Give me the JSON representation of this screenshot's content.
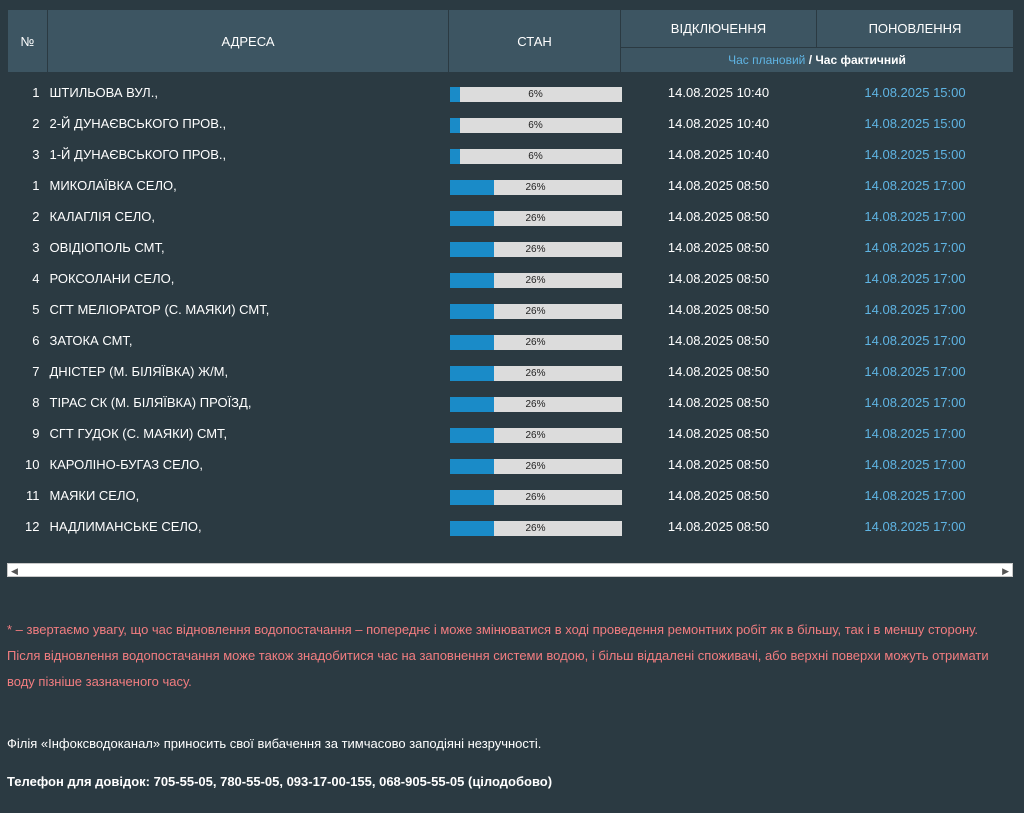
{
  "header": {
    "num": "№",
    "address": "АДРЕСА",
    "state": "СТАН",
    "disconnection": "ВІДКЛЮЧЕННЯ",
    "restoration": "ПОНОВЛЕННЯ",
    "planned_time": "Час плановий",
    "separator": " / ",
    "actual_time": "Час фактичний"
  },
  "rows": [
    {
      "num": "1",
      "address": "ШТИЛЬОВА ВУЛ.,",
      "progress": 6,
      "progress_label": "6%",
      "off": "14.08.2025 10:40",
      "upd": "14.08.2025 15:00"
    },
    {
      "num": "2",
      "address": "2-Й ДУНАЄВСЬКОГО ПРОВ.,",
      "progress": 6,
      "progress_label": "6%",
      "off": "14.08.2025 10:40",
      "upd": "14.08.2025 15:00"
    },
    {
      "num": "3",
      "address": "1-Й ДУНАЄВСЬКОГО ПРОВ.,",
      "progress": 6,
      "progress_label": "6%",
      "off": "14.08.2025 10:40",
      "upd": "14.08.2025 15:00"
    },
    {
      "num": "1",
      "address": "МИКОЛАЇВКА СЕЛО,",
      "progress": 26,
      "progress_label": "26%",
      "off": "14.08.2025 08:50",
      "upd": "14.08.2025 17:00"
    },
    {
      "num": "2",
      "address": "КАЛАГЛІЯ СЕЛО,",
      "progress": 26,
      "progress_label": "26%",
      "off": "14.08.2025 08:50",
      "upd": "14.08.2025 17:00"
    },
    {
      "num": "3",
      "address": "ОВІДІОПОЛЬ СМТ,",
      "progress": 26,
      "progress_label": "26%",
      "off": "14.08.2025 08:50",
      "upd": "14.08.2025 17:00"
    },
    {
      "num": "4",
      "address": "РОКСОЛАНИ СЕЛО,",
      "progress": 26,
      "progress_label": "26%",
      "off": "14.08.2025 08:50",
      "upd": "14.08.2025 17:00"
    },
    {
      "num": "5",
      "address": "СГТ МЕЛІОРАТОР (С. МАЯКИ) СМТ,",
      "progress": 26,
      "progress_label": "26%",
      "off": "14.08.2025 08:50",
      "upd": "14.08.2025 17:00"
    },
    {
      "num": "6",
      "address": "ЗАТОКА СМТ,",
      "progress": 26,
      "progress_label": "26%",
      "off": "14.08.2025 08:50",
      "upd": "14.08.2025 17:00"
    },
    {
      "num": "7",
      "address": "ДНІСТЕР (М. БІЛЯЇВКА) Ж/М,",
      "progress": 26,
      "progress_label": "26%",
      "off": "14.08.2025 08:50",
      "upd": "14.08.2025 17:00"
    },
    {
      "num": "8",
      "address": "ТІРАС СК (М. БІЛЯЇВКА) ПРОЇЗД,",
      "progress": 26,
      "progress_label": "26%",
      "off": "14.08.2025 08:50",
      "upd": "14.08.2025 17:00"
    },
    {
      "num": "9",
      "address": "СГТ ГУДОК (С. МАЯКИ) СМТ,",
      "progress": 26,
      "progress_label": "26%",
      "off": "14.08.2025 08:50",
      "upd": "14.08.2025 17:00"
    },
    {
      "num": "10",
      "address": "КАРОЛІНО-БУГАЗ СЕЛО,",
      "progress": 26,
      "progress_label": "26%",
      "off": "14.08.2025 08:50",
      "upd": "14.08.2025 17:00"
    },
    {
      "num": "11",
      "address": "МАЯКИ СЕЛО,",
      "progress": 26,
      "progress_label": "26%",
      "off": "14.08.2025 08:50",
      "upd": "14.08.2025 17:00"
    },
    {
      "num": "12",
      "address": "НАДЛИМАНСЬКЕ СЕЛО,",
      "progress": 26,
      "progress_label": "26%",
      "off": "14.08.2025 08:50",
      "upd": "14.08.2025 17:00"
    }
  ],
  "scrollbar": {
    "left_arrow": "◀",
    "right_arrow": "▶"
  },
  "notice": "* – звертаємо увагу, що час відновлення водопостачання – попереднє і може змінюватися в ході проведення ремонтних робіт як в більшу, так і в меншу сторону. Після відновлення водопостачання може також знадобитися час на заповнення системи водою, і більш віддалені споживачі, або верхні поверхи можуть отримати воду пізніше зазначеного часу.",
  "apology": "Філія «Інфоксводоканал» приносить свої вибачення за тимчасово заподіяні незручності.",
  "phone": "Телефон для довідок: 705-55-05, 780-55-05, 093-17-00-155, 068-905-55-05 (цілодобово)",
  "colors": {
    "background": "#2b3a42",
    "header": "#3d5562",
    "accent": "#5fb4e3",
    "bar_fill": "#1a8bc8",
    "notice": "#f27d80"
  }
}
